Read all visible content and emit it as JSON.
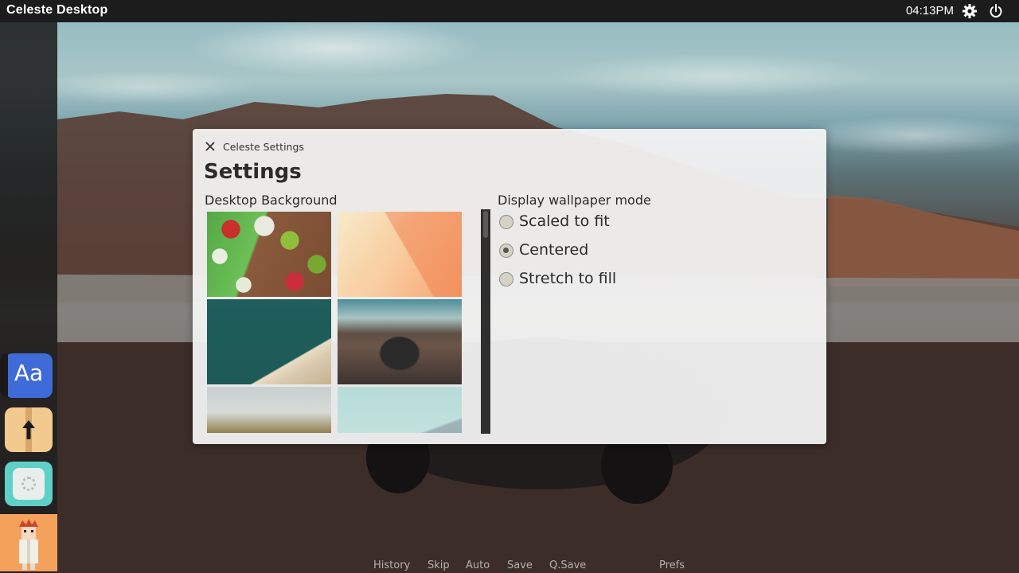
{
  "topbar": {
    "title": "Celeste Desktop",
    "clock": "04:13PM",
    "icons": [
      "gear-icon",
      "power-icon"
    ]
  },
  "dock": {
    "items": [
      {
        "name": "fonts",
        "label": "Aa",
        "color": "#3f6bd8"
      },
      {
        "name": "archive",
        "icon": "up-arrow-icon",
        "color": "#f2c98e"
      },
      {
        "name": "software",
        "icon": "software-center-icon",
        "color": "#5fd0c8"
      },
      {
        "name": "avatar",
        "icon": "character-avatar",
        "color": "#f4a15c"
      }
    ]
  },
  "window": {
    "title": "Celeste Settings",
    "heading": "Settings",
    "background_label": "Desktop Background",
    "thumbnails": [
      "apples",
      "peach-gradient",
      "lake-shore",
      "jeep-mountain",
      "forest-hills",
      "blue-mountain"
    ],
    "mode_label": "Display wallpaper mode",
    "modes": [
      {
        "label": "Scaled to fit",
        "selected": false
      },
      {
        "label": "Centered",
        "selected": true
      },
      {
        "label": "Stretch to fill",
        "selected": false
      }
    ]
  },
  "quick_menu": {
    "items": [
      "History",
      "Skip",
      "Auto",
      "Save",
      "Q.Save",
      "Prefs"
    ]
  },
  "colors": {
    "topbar": "#1c1c1c",
    "window": "#f4f4f4",
    "scrollbar": "#2f2f2f"
  }
}
